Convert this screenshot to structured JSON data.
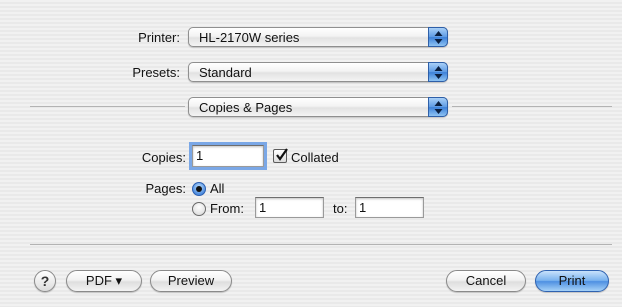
{
  "printer": {
    "label": "Printer:",
    "value": "HL-2170W series"
  },
  "presets": {
    "label": "Presets:",
    "value": "Standard"
  },
  "panel": {
    "value": "Copies & Pages"
  },
  "copies": {
    "label": "Copies:",
    "value": "1",
    "collated_label": "Collated",
    "collated_checked": true
  },
  "pages": {
    "label": "Pages:",
    "all_label": "All",
    "from_label": "From:",
    "from_value": "1",
    "to_label": "to:",
    "to_value": "1",
    "selected": "All"
  },
  "buttons": {
    "help": "?",
    "pdf": "PDF ▾",
    "preview": "Preview",
    "cancel": "Cancel",
    "print": "Print"
  },
  "colors": {
    "accent": "#4d8fe2",
    "focus": "#7aa7e6"
  }
}
